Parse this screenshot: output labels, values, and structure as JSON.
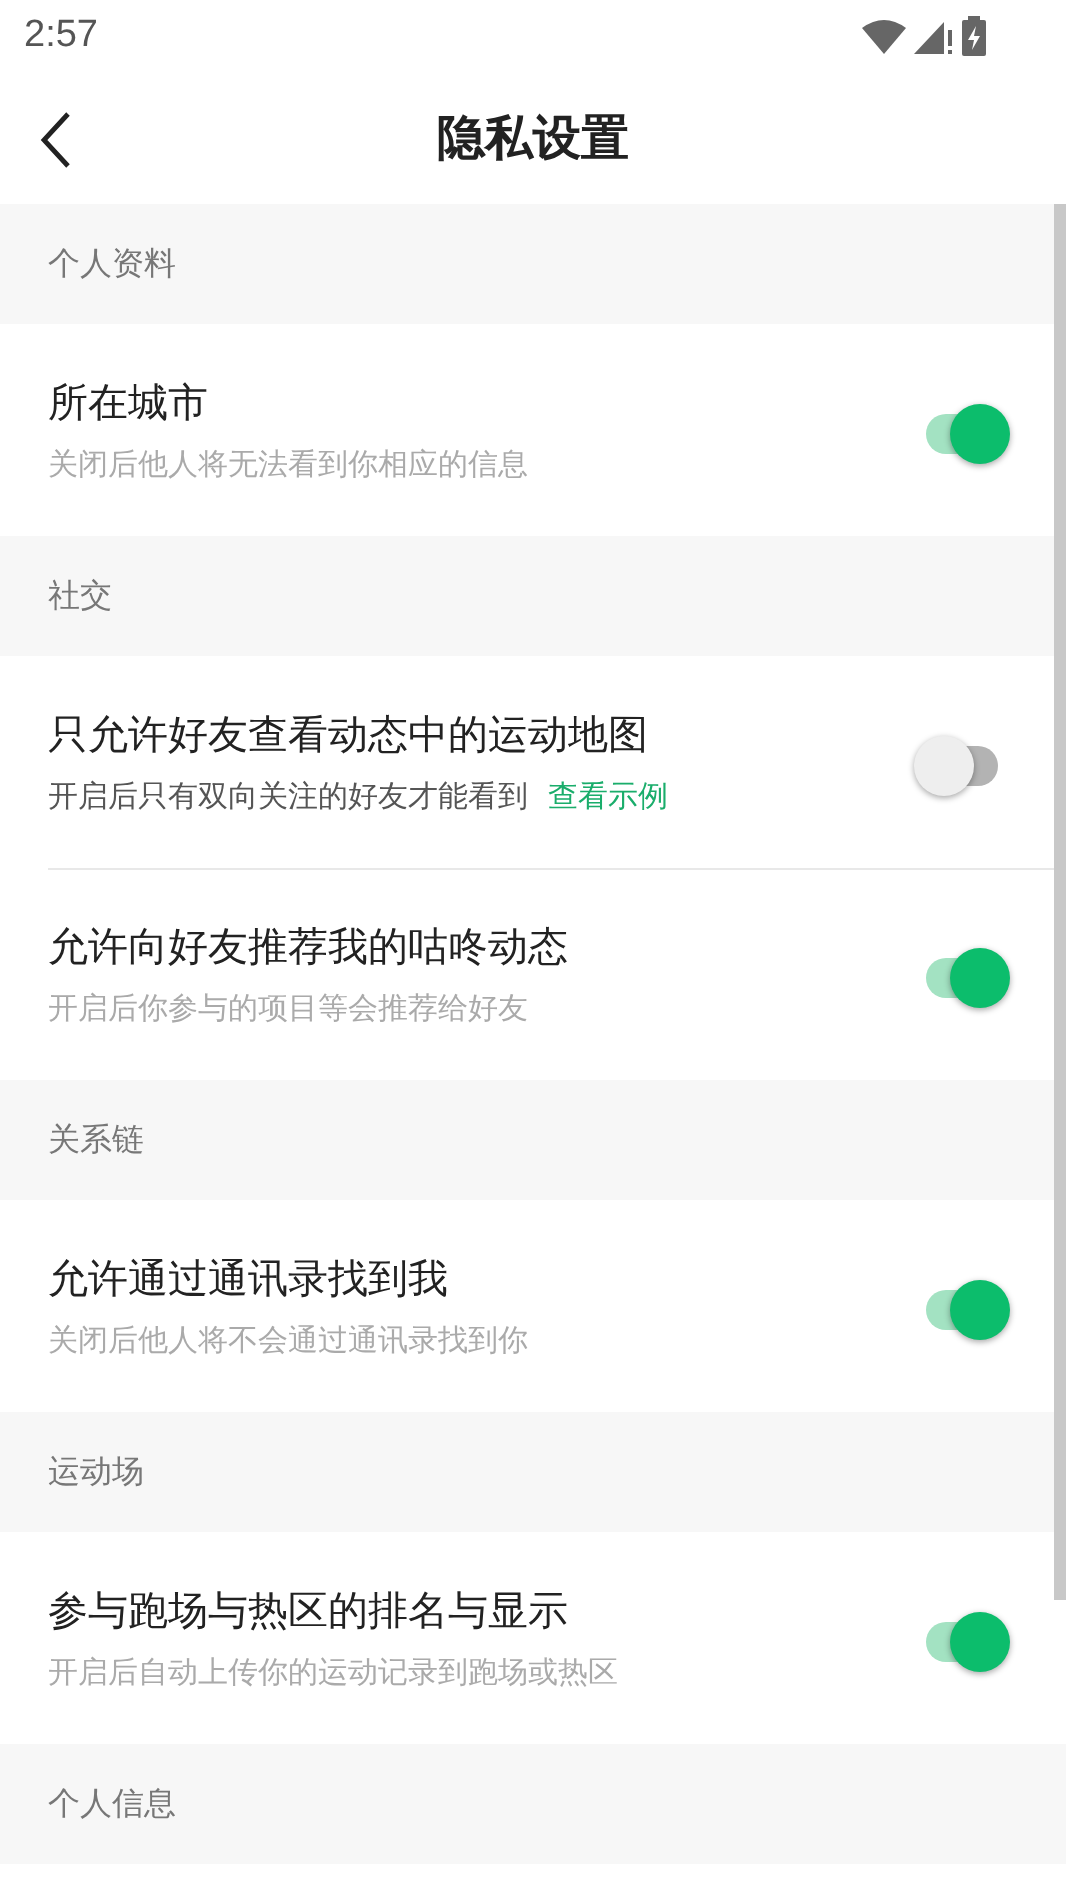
{
  "status_bar": {
    "time": "2:57"
  },
  "header": {
    "title": "隐私设置"
  },
  "sections": [
    {
      "title": "个人资料",
      "items": [
        {
          "title": "所在城市",
          "subtitle": "关闭后他人将无法看到你相应的信息",
          "on": true
        }
      ]
    },
    {
      "title": "社交",
      "items": [
        {
          "title": "只允许好友查看动态中的运动地图",
          "subtitle": "开启后只有双向关注的好友才能看到",
          "link": "查看示例",
          "on": false
        },
        {
          "title": "允许向好友推荐我的咕咚动态",
          "subtitle": "开启后你参与的项目等会推荐给好友",
          "on": true
        }
      ]
    },
    {
      "title": "关系链",
      "items": [
        {
          "title": "允许通过通讯录找到我",
          "subtitle": "关闭后他人将不会通过通讯录找到你",
          "on": true
        }
      ]
    },
    {
      "title": "运动场",
      "items": [
        {
          "title": "参与跑场与热区的排名与显示",
          "subtitle": "开启后自动上传你的运动记录到跑场或热区",
          "on": true
        }
      ]
    },
    {
      "title": "个人信息"
    }
  ]
}
